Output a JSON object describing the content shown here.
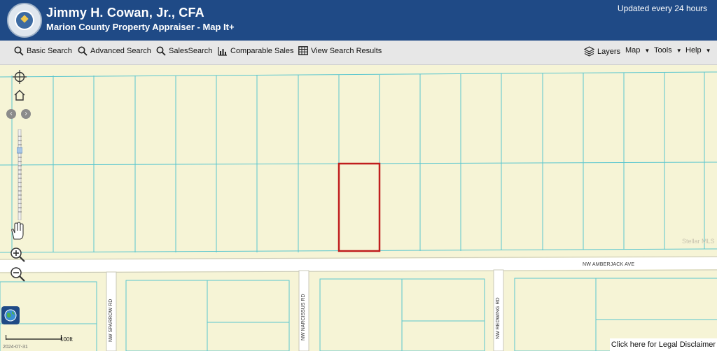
{
  "header": {
    "title": "Jimmy H. Cowan, Jr., CFA",
    "subtitle": "Marion County Property Appraiser - Map It+",
    "updated": "Updated every 24 hours",
    "seal_icon": "county-seal"
  },
  "toolbar": {
    "basic_search": "Basic Search",
    "advanced_search": "Advanced Search",
    "sales_search": "SalesSearch",
    "comparable_sales": "Comparable Sales",
    "view_results": "View Search Results",
    "layers": "Layers",
    "map": "Map",
    "tools": "Tools",
    "help": "Help"
  },
  "map": {
    "roads": {
      "main": "NW AMBERJACK AVE",
      "sparrow": "NW SPARROW RD",
      "narcissus": "NW NARCISSUS RD",
      "redwing": "NW REDWING RD"
    },
    "watermark": "Stellar MLS",
    "scale_label": "100ft",
    "date": "2024-07-31",
    "disclaimer": "Click here for Legal Disclaimer",
    "colors": {
      "parcel_line": "#59c6cf",
      "selected_parcel": "#c01d1d",
      "land": "#f6f4d6",
      "header": "#1f4a86"
    }
  }
}
